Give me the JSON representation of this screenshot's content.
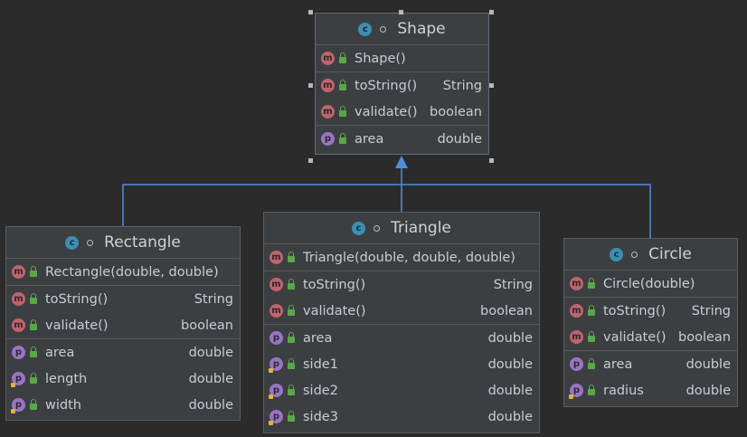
{
  "classes": {
    "shape": {
      "name": "Shape",
      "constructors": [
        {
          "name": "Shape()",
          "type": ""
        }
      ],
      "methods": [
        {
          "name": "toString()",
          "type": "String"
        },
        {
          "name": "validate()",
          "type": "boolean"
        }
      ],
      "fields": [
        {
          "name": "area",
          "type": "double"
        }
      ]
    },
    "rectangle": {
      "name": "Rectangle",
      "constructors": [
        {
          "name": "Rectangle(double, double)",
          "type": ""
        }
      ],
      "methods": [
        {
          "name": "toString()",
          "type": "String"
        },
        {
          "name": "validate()",
          "type": "boolean"
        }
      ],
      "fields": [
        {
          "name": "area",
          "type": "double"
        },
        {
          "name": "length",
          "type": "double"
        },
        {
          "name": "width",
          "type": "double"
        }
      ]
    },
    "triangle": {
      "name": "Triangle",
      "constructors": [
        {
          "name": "Triangle(double, double, double)",
          "type": ""
        }
      ],
      "methods": [
        {
          "name": "toString()",
          "type": "String"
        },
        {
          "name": "validate()",
          "type": "boolean"
        }
      ],
      "fields": [
        {
          "name": "area",
          "type": "double"
        },
        {
          "name": "side1",
          "type": "double"
        },
        {
          "name": "side2",
          "type": "double"
        },
        {
          "name": "side3",
          "type": "double"
        }
      ]
    },
    "circle": {
      "name": "Circle",
      "constructors": [
        {
          "name": "Circle(double)",
          "type": ""
        }
      ],
      "methods": [
        {
          "name": "toString()",
          "type": "String"
        },
        {
          "name": "validate()",
          "type": "boolean"
        }
      ],
      "fields": [
        {
          "name": "area",
          "type": "double"
        },
        {
          "name": "radius",
          "type": "double"
        }
      ]
    }
  },
  "icons": {
    "class": "c",
    "method": "m",
    "field": "p"
  },
  "colors": {
    "background": "#2b2b2b",
    "panel": "#3c3f41",
    "class_icon": "#3b8fb3",
    "method_icon": "#c0636e",
    "field_icon": "#9a74c4",
    "public_lock": "#5aa74a",
    "inheritance_line": "#4f8fe0"
  },
  "relations": [
    {
      "from": "Rectangle",
      "to": "Shape",
      "kind": "inheritance"
    },
    {
      "from": "Triangle",
      "to": "Shape",
      "kind": "inheritance"
    },
    {
      "from": "Circle",
      "to": "Shape",
      "kind": "inheritance"
    }
  ]
}
